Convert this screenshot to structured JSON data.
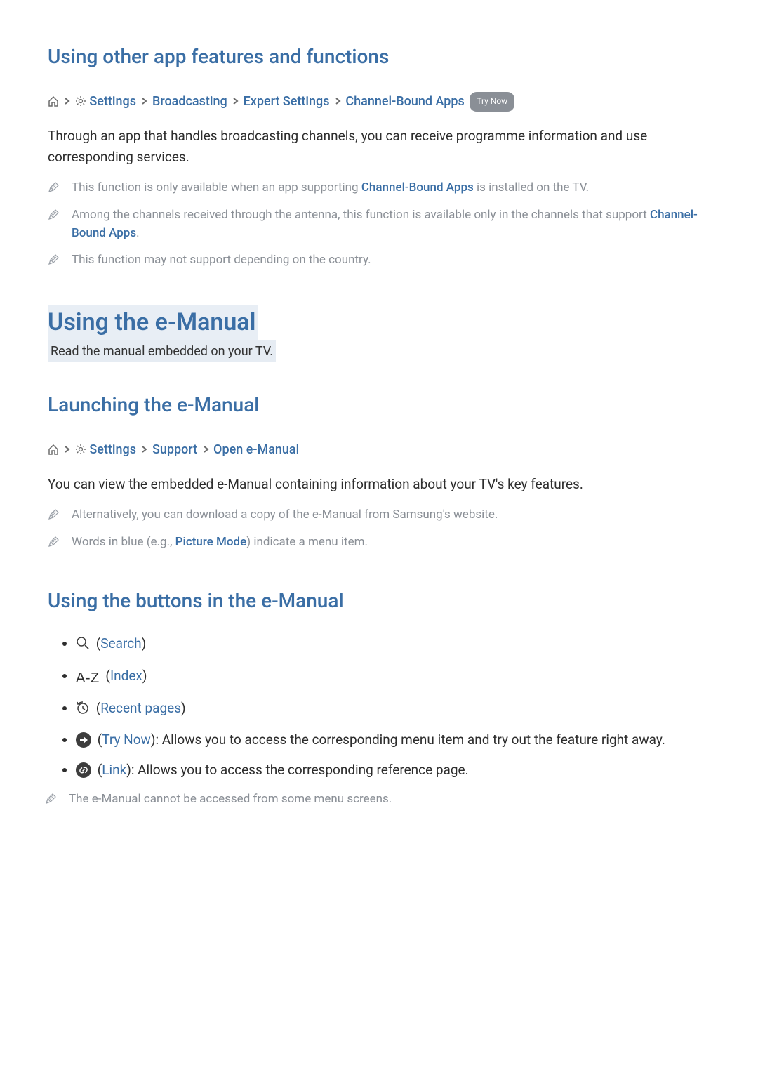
{
  "sec1": {
    "title": "Using other app features and functions",
    "breadcrumb": {
      "items": [
        "Settings",
        "Broadcasting",
        "Expert Settings",
        "Channel-Bound Apps"
      ],
      "try_now": "Try Now"
    },
    "body": "Through an app that handles broadcasting channels, you can receive programme information and use corresponding services.",
    "notes": [
      {
        "pre": "This function is only available when an app supporting ",
        "link": "Channel-Bound Apps",
        "post": " is installed on the TV."
      },
      {
        "pre": "Among the channels received through the antenna, this function is available only in the channels that support ",
        "link": "Channel-Bound Apps",
        "post": "."
      },
      {
        "pre": "This function may not support depending on the country.",
        "link": "",
        "post": ""
      }
    ]
  },
  "main": {
    "heading": "Using the e-Manual",
    "sub": "Read the manual embedded on your TV."
  },
  "sec2": {
    "title": "Launching the e-Manual",
    "breadcrumb": {
      "items": [
        "Settings",
        "Support",
        "Open e-Manual"
      ]
    },
    "body": "You can view the embedded e-Manual containing information about your TV's key features.",
    "notes": [
      {
        "pre": "Alternatively, you can download a copy of the e-Manual from Samsung's website.",
        "link": "",
        "post": ""
      },
      {
        "pre": "Words in blue (e.g., ",
        "link": "Picture Mode",
        "post": ") indicate a menu item."
      }
    ]
  },
  "sec3": {
    "title": "Using the buttons in the e-Manual",
    "bullets": {
      "search": "Search",
      "index": "Index",
      "recent": "Recent pages",
      "trynow_label": "Try Now",
      "trynow_desc": ": Allows you to access the corresponding menu item and try out the feature right away.",
      "link_label": "Link",
      "link_desc": ": Allows you to access the corresponding reference page."
    },
    "note": "The e-Manual cannot be accessed from some menu screens."
  }
}
